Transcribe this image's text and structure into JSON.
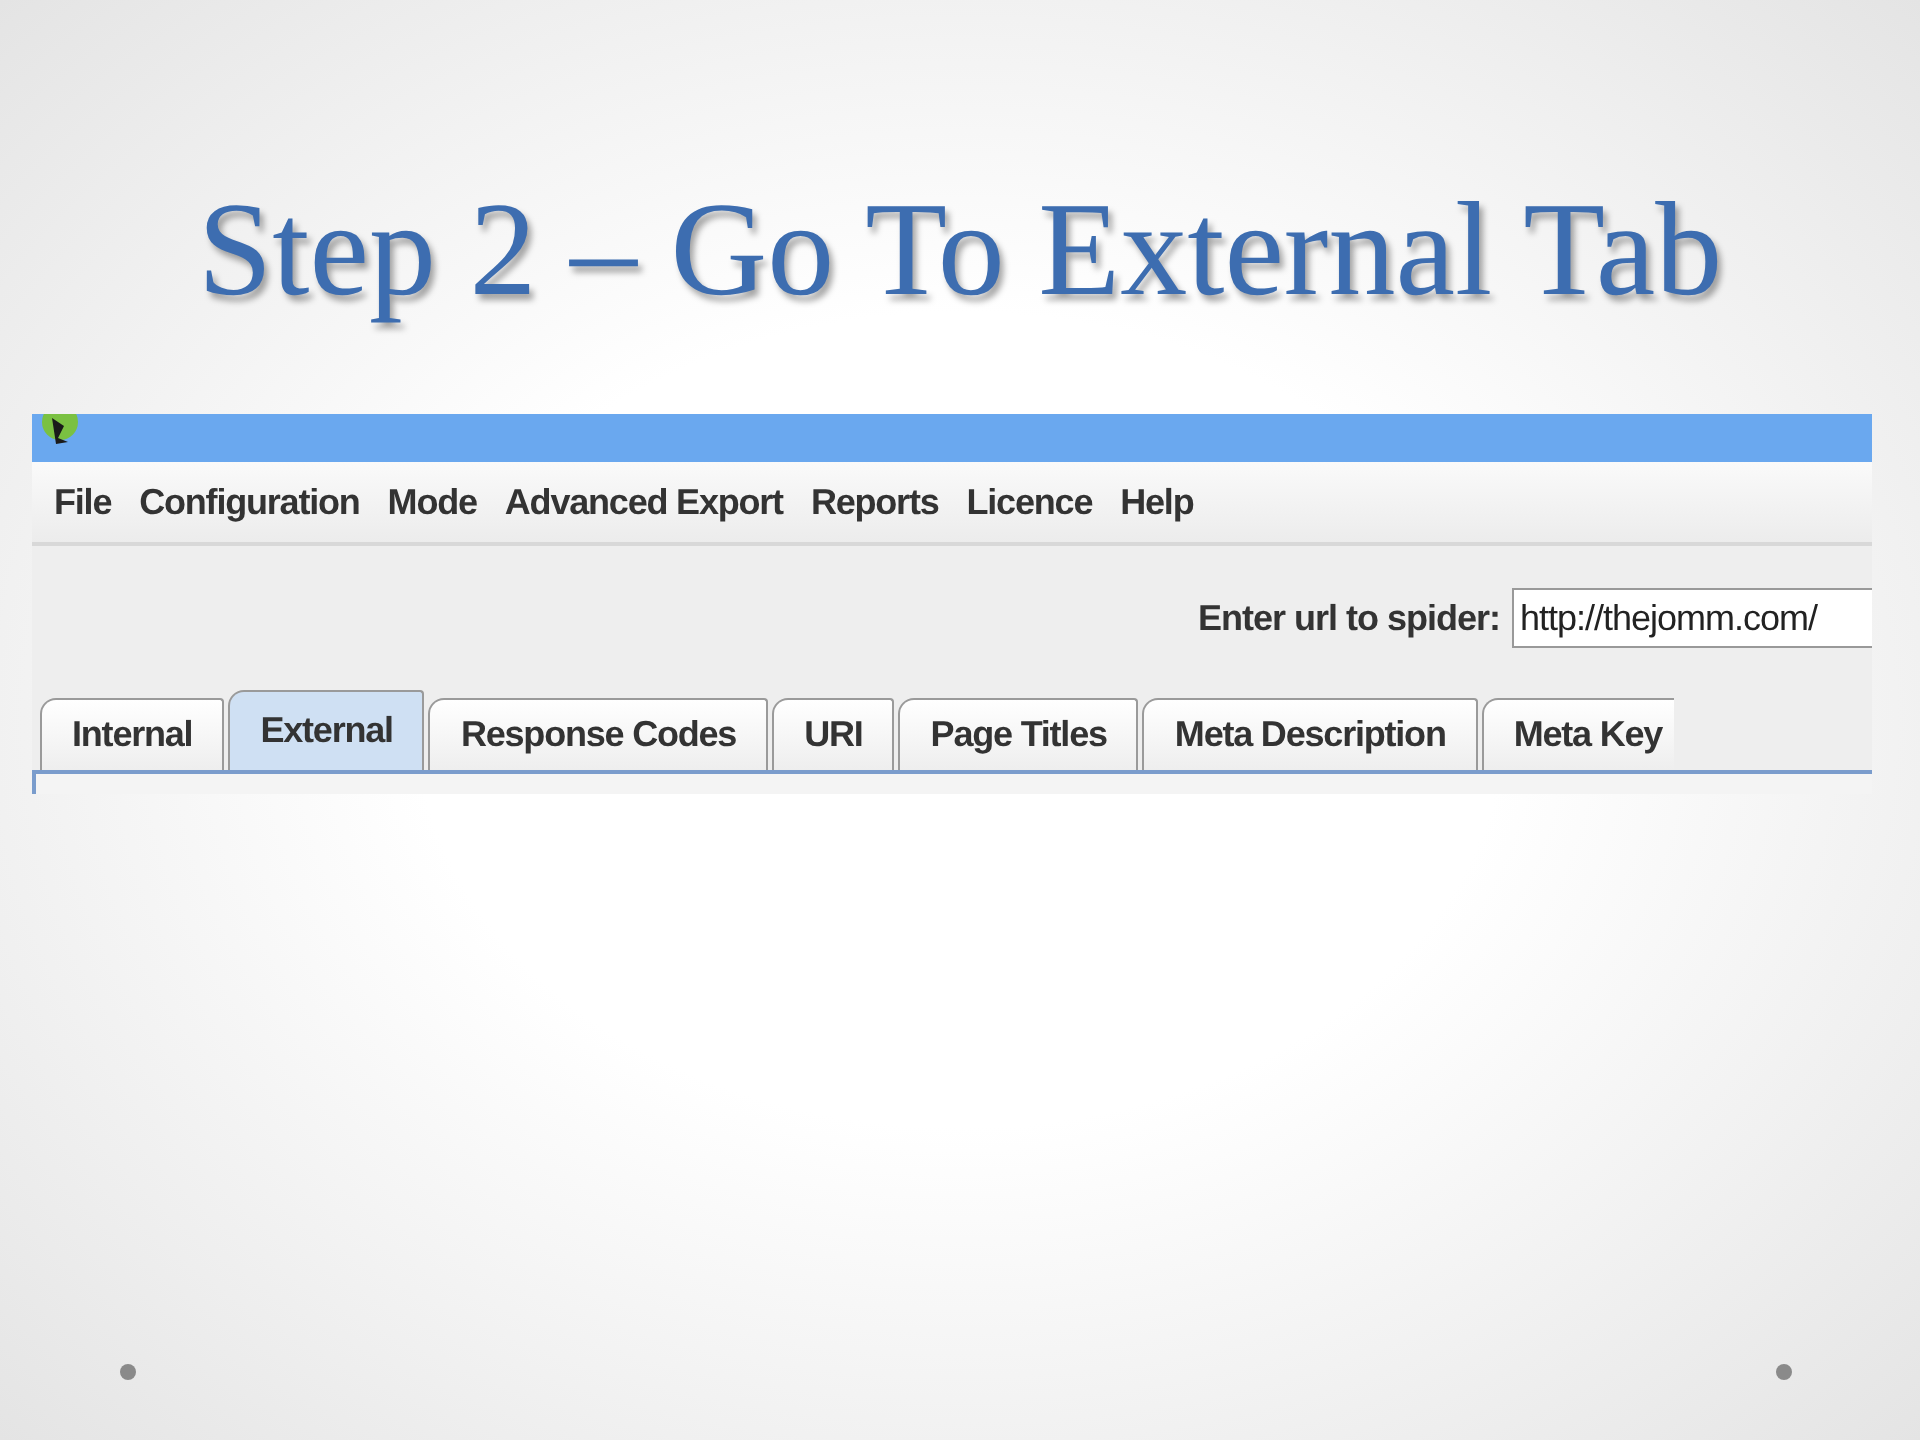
{
  "slide": {
    "title": "Step 2 – Go To External Tab"
  },
  "menu": [
    "File",
    "Configuration",
    "Mode",
    "Advanced Export",
    "Reports",
    "Licence",
    "Help"
  ],
  "url_bar": {
    "label": "Enter url to spider:",
    "value": "http://thejomm.com/"
  },
  "tabs": [
    {
      "label": "Internal",
      "selected": false
    },
    {
      "label": "External",
      "selected": true
    },
    {
      "label": "Response Codes",
      "selected": false
    },
    {
      "label": "URI",
      "selected": false
    },
    {
      "label": "Page Titles",
      "selected": false
    },
    {
      "label": "Meta Description",
      "selected": false
    },
    {
      "label": "Meta Key",
      "selected": false
    }
  ]
}
